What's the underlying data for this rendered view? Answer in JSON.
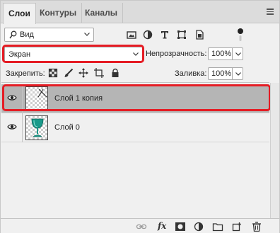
{
  "tabs": [
    {
      "label": "Слои",
      "active": true
    },
    {
      "label": "Контуры",
      "active": false
    },
    {
      "label": "Каналы",
      "active": false
    }
  ],
  "filter": {
    "label": "Вид"
  },
  "filter_icons": [
    "image-filter-icon",
    "adjustment-filter-icon",
    "type-filter-icon",
    "shape-filter-icon",
    "smart-object-filter-icon"
  ],
  "blend": {
    "value": "Экран"
  },
  "opacity": {
    "label": "Непрозрачность:",
    "value": "100%"
  },
  "lock": {
    "label": "Закрепить:"
  },
  "fill": {
    "label": "Заливка:",
    "value": "100%"
  },
  "layers": [
    {
      "name": "Слой 1 копия",
      "selected": true,
      "visible": true
    },
    {
      "name": "Слой 0",
      "selected": false,
      "visible": true
    }
  ],
  "colors": {
    "highlight": "#e51c24",
    "selected_row": "#b5b5b5",
    "accent_glass": "#1a9a8a"
  }
}
